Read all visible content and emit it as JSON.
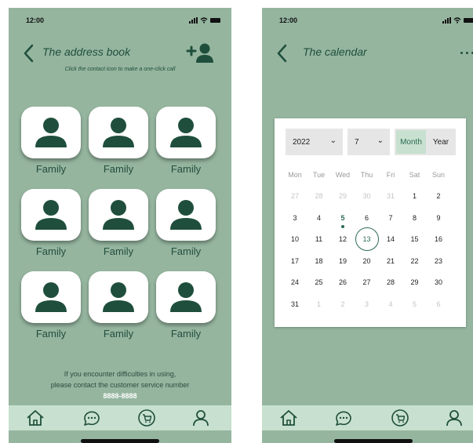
{
  "left": {
    "status_time": "12:00",
    "title": "The address book",
    "subtitle": "Click the contact icon to make a one-click call",
    "contacts": [
      {
        "label": "Family"
      },
      {
        "label": "Family"
      },
      {
        "label": "Family"
      },
      {
        "label": "Family"
      },
      {
        "label": "Family"
      },
      {
        "label": "Family"
      },
      {
        "label": "Family"
      },
      {
        "label": "Family"
      },
      {
        "label": "Family"
      }
    ],
    "help_line1": "If you encounter difficulties in using,",
    "help_line2": "please contact the customer service number",
    "help_number": "8888-8888"
  },
  "right": {
    "status_time": "12:00",
    "title": "The calendar",
    "calendar": {
      "year": "2022",
      "month": "7",
      "view_month": "Month",
      "view_year": "Year",
      "weekdays": [
        "Mon",
        "Tue",
        "Wed",
        "Thu",
        "Fri",
        "Sat",
        "Sun"
      ],
      "weeks": [
        [
          "27",
          "28",
          "29",
          "30",
          "31",
          "1",
          "2"
        ],
        [
          "3",
          "4",
          "5",
          "6",
          "7",
          "8",
          "9"
        ],
        [
          "10",
          "11",
          "12",
          "13",
          "14",
          "15",
          "16"
        ],
        [
          "17",
          "18",
          "19",
          "20",
          "21",
          "22",
          "23"
        ],
        [
          "24",
          "25",
          "26",
          "27",
          "28",
          "29",
          "30"
        ],
        [
          "31",
          "1",
          "2",
          "3",
          "4",
          "5",
          "6"
        ]
      ],
      "today": "5",
      "selected": "13"
    }
  },
  "icons": {
    "back": "chevron-left-icon",
    "add_contact": "add-contact-icon",
    "contact": "person-icon",
    "tabs": [
      "home-icon",
      "chat-icon",
      "cart-icon",
      "profile-icon"
    ],
    "menu": "more-dots-icon"
  },
  "colors": {
    "background": "#95b59f",
    "accent": "#1f4f3c",
    "tabbar": "#c8e0cf",
    "highlight": "#2b6b55"
  }
}
